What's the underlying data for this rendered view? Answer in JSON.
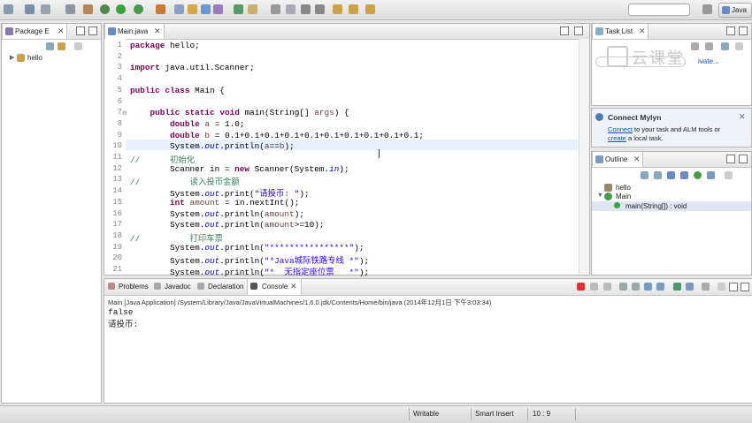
{
  "toolbar": {
    "perspective_label": "Java"
  },
  "package_explorer": {
    "tab_label": "Package E",
    "tree": [
      {
        "label": "hello"
      }
    ]
  },
  "editor": {
    "tab_label": "Main.java",
    "status_line": "10",
    "lines": [
      {
        "n": "1",
        "t": "package hello;"
      },
      {
        "n": "2",
        "t": ""
      },
      {
        "n": "3",
        "t": "import java.util.Scanner;"
      },
      {
        "n": "4",
        "t": ""
      },
      {
        "n": "5",
        "t": "public class Main {"
      },
      {
        "n": "6",
        "t": ""
      },
      {
        "n": "7",
        "t": "    public static void main(String[] args) {"
      },
      {
        "n": "8",
        "t": "        double a = 1.0;"
      },
      {
        "n": "9",
        "t": "        double b = 0.1+0.1+0.1+0.1+0.1+0.1+0.1+0.1+0.1+0.1;"
      },
      {
        "n": "10",
        "t": "        System.out.println(a==b);"
      },
      {
        "n": "11",
        "t": "//      初始化"
      },
      {
        "n": "12",
        "t": "        Scanner in = new Scanner(System.in);"
      },
      {
        "n": "13",
        "t": "//          读入投币金额"
      },
      {
        "n": "14",
        "t": "        System.out.print(\"请投币: \");"
      },
      {
        "n": "15",
        "t": "        int amount = in.nextInt();"
      },
      {
        "n": "16",
        "t": "        System.out.println(amount);"
      },
      {
        "n": "17",
        "t": "        System.out.println(amount>=10);"
      },
      {
        "n": "18",
        "t": "//          打印车票"
      },
      {
        "n": "19",
        "t": "        System.out.println(\"****************\");"
      },
      {
        "n": "20",
        "t": "        System.out.println(\"*Java城际铁路专线 *\");"
      },
      {
        "n": "21",
        "t": "        System.out.println(\"*  无指定座位票   *\");"
      }
    ]
  },
  "task_list": {
    "tab_label": "Task List",
    "activate_text": "ivate..."
  },
  "mylyn": {
    "title": "Connect Mylyn",
    "connect_link": "Connect",
    "text1": " to your task and ALM tools or",
    "create_link": "create",
    "text2": " a local task."
  },
  "outline": {
    "tab_label": "Outline",
    "items": [
      {
        "label": "hello"
      },
      {
        "label": "Main"
      },
      {
        "label": "main(String[]) : void"
      }
    ]
  },
  "bottom_tabs": {
    "problems": "Problems",
    "javadoc": "Javadoc",
    "declaration": "Declaration",
    "console": "Console"
  },
  "console": {
    "header": "Main [Java Application] /System/Library/Java/JavaVirtualMachines/1.6.0.jdk/Contents/Home/bin/java (2014年12月1日 下午3:03:34)",
    "output": [
      "false",
      "请投币:"
    ]
  },
  "statusbar": {
    "writable": "Writable",
    "insert_mode": "Smart Insert",
    "position": "10 : 9"
  },
  "watermark": {
    "text": "云课堂"
  },
  "colors": {
    "keyword": "#7f0055",
    "string": "#2a00ff",
    "comment": "#3f7f5f",
    "field": "#0000c0",
    "link": "#1a4fb8"
  }
}
